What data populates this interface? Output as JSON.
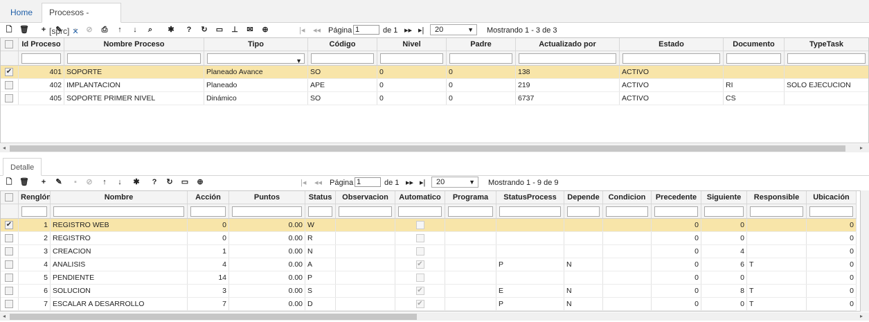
{
  "tabs": [
    {
      "label": "Home"
    },
    {
      "label": "Procesos -[sprc]"
    }
  ],
  "colors": {
    "accent": "#1f5fa8",
    "selected_row": "#f8e5a9"
  },
  "processes": {
    "pager": {
      "page_label": "Página",
      "page_value": "1",
      "of_label": "de 1",
      "page_size": "20",
      "showing": "Mostrando 1 - 3 de 3"
    },
    "columns": [
      "Id Proceso",
      "Nombre Proceso",
      "Tipo",
      "Código",
      "Nivel",
      "Padre",
      "Actualizado por",
      "Estado",
      "Documento",
      "TypeTask"
    ],
    "rows": [
      {
        "id": "401",
        "nombre": "SOPORTE",
        "tipo": "Planeado Avance",
        "codigo": "SO",
        "nivel": "0",
        "padre": "0",
        "actualizado": "138",
        "estado": "ACTIVO",
        "documento": "",
        "typetask": ""
      },
      {
        "id": "402",
        "nombre": "IMPLANTACION",
        "tipo": "Planeado",
        "codigo": "APE",
        "nivel": "0",
        "padre": "0",
        "actualizado": "219",
        "estado": "ACTIVO",
        "documento": "RI",
        "typetask": "SOLO EJECUCION"
      },
      {
        "id": "405",
        "nombre": "SOPORTE PRIMER NIVEL",
        "tipo": "Dinámico",
        "codigo": "SO",
        "nivel": "0",
        "padre": "0",
        "actualizado": "6737",
        "estado": "ACTIVO",
        "documento": "CS",
        "typetask": ""
      }
    ]
  },
  "detail": {
    "tab_label": "Detalle",
    "pager": {
      "page_label": "Página",
      "page_value": "1",
      "of_label": "de 1",
      "page_size": "20",
      "showing": "Mostrando 1 - 9 de 9"
    },
    "columns": [
      "Renglón",
      "Nombre",
      "Acción",
      "Puntos",
      "Status",
      "Observacion",
      "Automatico",
      "Programa",
      "StatusProcess",
      "Depende",
      "Condicion",
      "Precedente",
      "Siguiente",
      "Responsible",
      "Ubicación"
    ],
    "rows": [
      {
        "renglon": "1",
        "nombre": "REGISTRO WEB",
        "accion": "0",
        "puntos": "0.00",
        "status": "W",
        "auto": false,
        "statusprocess": "",
        "depende": "",
        "precedente": "0",
        "siguiente": "0",
        "responsible": "",
        "ubicacion": "0"
      },
      {
        "renglon": "2",
        "nombre": "REGISTRO",
        "accion": "0",
        "puntos": "0.00",
        "status": "R",
        "auto": false,
        "statusprocess": "",
        "depende": "",
        "precedente": "0",
        "siguiente": "0",
        "responsible": "",
        "ubicacion": "0"
      },
      {
        "renglon": "3",
        "nombre": "CREACION",
        "accion": "1",
        "puntos": "0.00",
        "status": "N",
        "auto": false,
        "statusprocess": "",
        "depende": "",
        "precedente": "0",
        "siguiente": "4",
        "responsible": "",
        "ubicacion": "0"
      },
      {
        "renglon": "4",
        "nombre": "ANALISIS",
        "accion": "4",
        "puntos": "0.00",
        "status": "A",
        "auto": true,
        "statusprocess": "P",
        "depende": "N",
        "precedente": "0",
        "siguiente": "6",
        "responsible": "T",
        "ubicacion": "0"
      },
      {
        "renglon": "5",
        "nombre": "PENDIENTE",
        "accion": "14",
        "puntos": "0.00",
        "status": "P",
        "auto": false,
        "statusprocess": "",
        "depende": "",
        "precedente": "0",
        "siguiente": "0",
        "responsible": "",
        "ubicacion": "0"
      },
      {
        "renglon": "6",
        "nombre": "SOLUCION",
        "accion": "3",
        "puntos": "0.00",
        "status": "S",
        "auto": true,
        "statusprocess": "E",
        "depende": "N",
        "precedente": "0",
        "siguiente": "8",
        "responsible": "T",
        "ubicacion": "0"
      },
      {
        "renglon": "7",
        "nombre": "ESCALAR A DESARROLLO",
        "accion": "7",
        "puntos": "0.00",
        "status": "D",
        "auto": true,
        "statusprocess": "P",
        "depende": "N",
        "precedente": "0",
        "siguiente": "0",
        "responsible": "T",
        "ubicacion": "0"
      }
    ]
  }
}
